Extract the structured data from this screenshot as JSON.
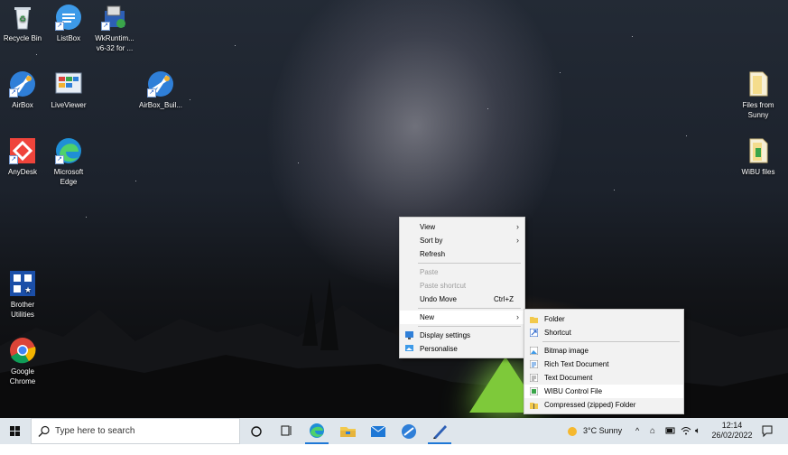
{
  "desktop_icons": [
    {
      "label": "Recycle Bin"
    },
    {
      "label": "ListBox"
    },
    {
      "label": "WkRuntim...\nv6-32 for ..."
    },
    {
      "label": "AirBox"
    },
    {
      "label": "LiveViewer"
    },
    {
      "label": "AirBox_Buil..."
    },
    {
      "label": "AnyDesk"
    },
    {
      "label": "Microsoft\nEdge"
    },
    {
      "label": "Brother\nUtilities"
    },
    {
      "label": "Google\nChrome"
    },
    {
      "label": "Files from\nSunny"
    },
    {
      "label": "WiBU files"
    }
  ],
  "context_menu": {
    "view": "View",
    "sort_by": "Sort by",
    "refresh": "Refresh",
    "paste": "Paste",
    "paste_shortcut": "Paste shortcut",
    "undo_move": "Undo Move",
    "undo_shortcut": "Ctrl+Z",
    "new": "New",
    "display_settings": "Display settings",
    "personalise": "Personalise"
  },
  "new_submenu": {
    "folder": "Folder",
    "shortcut": "Shortcut",
    "bitmap_image": "Bitmap image",
    "rich_text_document": "Rich Text Document",
    "text_document": "Text Document",
    "wibu_control_file": "WIBU Control File",
    "compressed_folder": "Compressed (zipped) Folder"
  },
  "taskbar": {
    "search_placeholder": "Type here to search",
    "weather": "3°C  Sunny",
    "time": "12:14",
    "date": "26/02/2022"
  },
  "colors": {
    "accent": "#1e78d6",
    "taskbar": "#dfe6ec",
    "menu": "#f2f2f2"
  }
}
